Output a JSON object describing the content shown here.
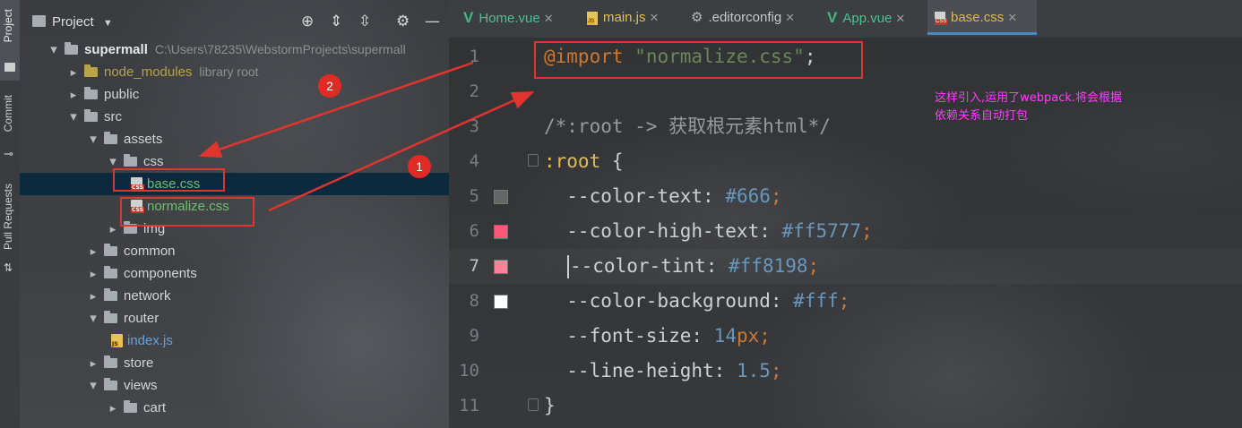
{
  "sidebar_tabs": {
    "project": "Project",
    "commit": "Commit",
    "pull_requests": "Pull Requests"
  },
  "project_panel": {
    "title": "Project",
    "tree": [
      {
        "name": "supermall",
        "hint": "C:\\Users\\78235\\WebstormProjects\\supermall",
        "type": "folder",
        "depth": 0,
        "expanded": true
      },
      {
        "name": "node_modules",
        "hint": "library root",
        "type": "folder-excluded",
        "depth": 1,
        "expanded": false
      },
      {
        "name": "public",
        "type": "folder",
        "depth": 1,
        "expanded": false
      },
      {
        "name": "src",
        "type": "folder",
        "depth": 1,
        "expanded": true
      },
      {
        "name": "assets",
        "type": "folder",
        "depth": 2,
        "expanded": true
      },
      {
        "name": "css",
        "type": "folder",
        "depth": 3,
        "expanded": true
      },
      {
        "name": "base.css",
        "type": "css",
        "depth": 4,
        "selected": true
      },
      {
        "name": "normalize.css",
        "type": "css",
        "depth": 4
      },
      {
        "name": "img",
        "type": "folder",
        "depth": 3,
        "expanded": false
      },
      {
        "name": "common",
        "type": "folder",
        "depth": 2,
        "expanded": false
      },
      {
        "name": "components",
        "type": "folder",
        "depth": 2,
        "expanded": false
      },
      {
        "name": "network",
        "type": "folder",
        "depth": 2,
        "expanded": false
      },
      {
        "name": "router",
        "type": "folder",
        "depth": 2,
        "expanded": true
      },
      {
        "name": "index.js",
        "type": "js",
        "depth": 3
      },
      {
        "name": "store",
        "type": "folder",
        "depth": 2,
        "expanded": false
      },
      {
        "name": "views",
        "type": "folder",
        "depth": 2,
        "expanded": true
      },
      {
        "name": "cart",
        "type": "folder",
        "depth": 3,
        "expanded": false
      }
    ]
  },
  "tabs": [
    {
      "label": "Home.vue",
      "kind": "vue"
    },
    {
      "label": "main.js",
      "kind": "js"
    },
    {
      "label": ".editorconfig",
      "kind": "config"
    },
    {
      "label": "App.vue",
      "kind": "vue"
    },
    {
      "label": "base.css",
      "kind": "css",
      "active": true
    }
  ],
  "editor": {
    "current_line": 7,
    "lines": [
      {
        "n": "1",
        "parts": [
          [
            "kw",
            "@import"
          ],
          [
            "punc",
            " "
          ],
          [
            "str",
            "\"normalize.css\""
          ],
          [
            "punc",
            ";"
          ]
        ]
      },
      {
        "n": "2",
        "parts": []
      },
      {
        "n": "3",
        "parts": [
          [
            "cm",
            "/*:root -> 获取根元素html*/"
          ]
        ]
      },
      {
        "n": "4",
        "fold": true,
        "parts": [
          [
            "sel",
            ":root"
          ],
          [
            "punc",
            " {"
          ]
        ]
      },
      {
        "n": "5",
        "swatch": "#666666",
        "parts": [
          [
            "prop",
            "  --color-text"
          ],
          [
            "punc",
            ": "
          ],
          [
            "num",
            "#666"
          ],
          [
            "kw",
            ";"
          ]
        ]
      },
      {
        "n": "6",
        "swatch": "#ff5777",
        "parts": [
          [
            "prop",
            "  --color-high-text"
          ],
          [
            "punc",
            ": "
          ],
          [
            "num",
            "#ff5777"
          ],
          [
            "kw",
            ";"
          ]
        ]
      },
      {
        "n": "7",
        "swatch": "#ff8198",
        "caret": true,
        "parts": [
          [
            "prop",
            "--color-tint"
          ],
          [
            "punc",
            ": "
          ],
          [
            "num",
            "#ff8198"
          ],
          [
            "kw",
            ";"
          ]
        ]
      },
      {
        "n": "8",
        "swatch": "#ffffff",
        "parts": [
          [
            "prop",
            "  --color-background"
          ],
          [
            "punc",
            ": "
          ],
          [
            "num",
            "#fff"
          ],
          [
            "kw",
            ";"
          ]
        ]
      },
      {
        "n": "9",
        "parts": [
          [
            "prop",
            "  --font-size"
          ],
          [
            "punc",
            ": "
          ],
          [
            "num",
            "14"
          ],
          [
            "kw",
            "px;"
          ]
        ]
      },
      {
        "n": "10",
        "parts": [
          [
            "prop",
            "  --line-height"
          ],
          [
            "punc",
            ": "
          ],
          [
            "num",
            "1.5"
          ],
          [
            "kw",
            ";"
          ]
        ]
      },
      {
        "n": "11",
        "fold": true,
        "parts": [
          [
            "punc",
            "}"
          ]
        ]
      }
    ]
  },
  "annotations": {
    "note_line1": "这样引入,运用了webpack.将会根据",
    "note_line2": "依赖关系自动打包",
    "badge1": "1",
    "badge2": "2"
  },
  "colors": {
    "annotation_red": "#e0342f",
    "note_magenta": "#ff3cff",
    "selection": "#0d293e"
  }
}
